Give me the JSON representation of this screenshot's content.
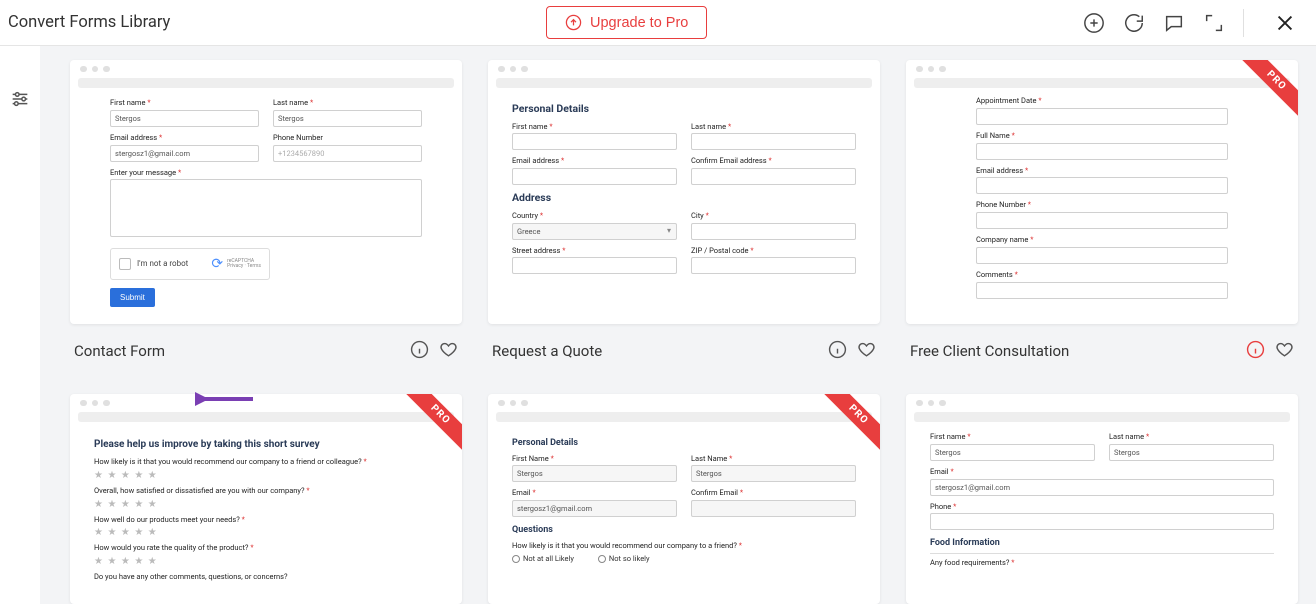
{
  "header": {
    "title": "Convert Forms Library",
    "upgrade_label": "Upgrade to Pro"
  },
  "ribbon": {
    "label": "PRO"
  },
  "cards": [
    {
      "title": "Contact Form",
      "pro": false,
      "fields": {
        "fn_label": "First name",
        "fn_val": "Stergos",
        "ln_label": "Last name",
        "ln_val": "Stergos",
        "em_label": "Email address",
        "em_val": "stergosz1@gmail.com",
        "ph_label": "Phone Number",
        "ph_val": "+1234567890",
        "msg_label": "Enter your message",
        "captcha_label": "I'm not a robot",
        "captcha_brand": "reCAPTCHA",
        "captcha_fine": "Privacy · Terms",
        "submit": "Submit"
      }
    },
    {
      "title": "Request a Quote",
      "pro": false,
      "fields": {
        "sect1": "Personal Details",
        "fn_label": "First name",
        "ln_label": "Last name",
        "em_label": "Email address",
        "cem_label": "Confirm Email address",
        "sect2": "Address",
        "country_label": "Country",
        "country_val": "Greece",
        "city_label": "City",
        "street_label": "Street address",
        "zip_label": "ZIP / Postal code"
      }
    },
    {
      "title": "Free Client Consultation",
      "pro": true,
      "info_red": true,
      "fields": {
        "ad_label": "Appointment Date",
        "fn_label": "Full Name",
        "em_label": "Email address",
        "ph_label": "Phone Number",
        "co_label": "Company name",
        "cm_label": "Comments"
      }
    },
    {
      "title": "",
      "pro": true,
      "fields": {
        "head": "Please help us improve by taking this short survey",
        "q1": "How likely is it that you would recommend our company to a friend or colleague?",
        "q2": "Overall, how satisfied or dissatisfied are you with our company?",
        "q3": "How well do our products meet your needs?",
        "q4": "How would you rate the quality of the product?",
        "q5": "Do you have any other comments, questions, or concerns?"
      }
    },
    {
      "title": "",
      "pro": true,
      "fields": {
        "sect1": "Personal Details",
        "fn_label": "First Name",
        "fn_val": "Stergos",
        "ln_label": "Last Name",
        "ln_val": "Stergos",
        "em_label": "Email",
        "em_val": "stergosz1@gmail.com",
        "cem_label": "Confirm Email",
        "sect2": "Questions",
        "q1": "How likely is it that you would recommend our company to a friend?",
        "opt1": "Not at all Likely",
        "opt2": "Not so likely"
      }
    },
    {
      "title": "",
      "pro": false,
      "fields": {
        "fn_label": "First name",
        "fn_val": "Stergos",
        "ln_label": "Last name",
        "ln_val": "Stergos",
        "em_label": "Email",
        "em_val": "stergosz1@gmail.com",
        "ph_label": "Phone",
        "sect2": "Food Information",
        "q1": "Any food requirements?"
      }
    }
  ]
}
